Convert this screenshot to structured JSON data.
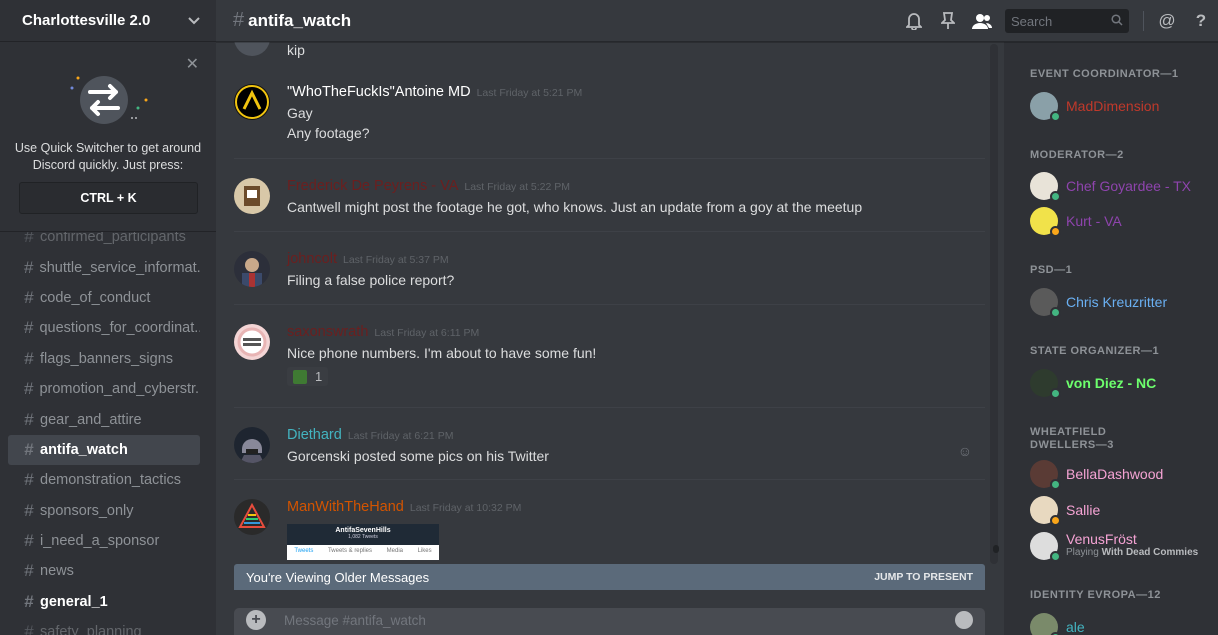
{
  "server": {
    "name": "Charlottesville 2.0"
  },
  "quick_switcher": {
    "text": "Use Quick Switcher to get around Discord quickly. Just press:",
    "shortcut": "CTRL + K"
  },
  "channels": [
    {
      "name": "confirmed_participants",
      "state": "faded"
    },
    {
      "name": "shuttle_service_informat...",
      "state": "normal"
    },
    {
      "name": "code_of_conduct",
      "state": "normal"
    },
    {
      "name": "questions_for_coordinat...",
      "state": "normal"
    },
    {
      "name": "flags_banners_signs",
      "state": "normal"
    },
    {
      "name": "promotion_and_cyberstr...",
      "state": "normal"
    },
    {
      "name": "gear_and_attire",
      "state": "normal"
    },
    {
      "name": "antifa_watch",
      "state": "active"
    },
    {
      "name": "demonstration_tactics",
      "state": "normal"
    },
    {
      "name": "sponsors_only",
      "state": "normal"
    },
    {
      "name": "i_need_a_sponsor",
      "state": "normal"
    },
    {
      "name": "news",
      "state": "normal"
    },
    {
      "name": "general_1",
      "state": "unread"
    },
    {
      "name": "safety_planning",
      "state": "faded"
    }
  ],
  "header": {
    "channel": "antifa_watch",
    "search_placeholder": "Search"
  },
  "messages": [
    {
      "top_text": "kip"
    },
    {
      "author": "\"WhoTheFuckIs\"Antoine MD",
      "color": "#ffffff",
      "time": "Last Friday at 5:21 PM",
      "lines": [
        "Gay",
        "Any footage?"
      ]
    },
    {
      "author": "Frederick De Peyrens - VA",
      "color": "#6b1f1f",
      "time": "Last Friday at 5:22 PM",
      "lines": [
        "Cantwell might post the footage he got, who knows. Just an update from a goy at the meetup"
      ]
    },
    {
      "author": "johncolt",
      "color": "#6b1f1f",
      "time": "Last Friday at 5:37 PM",
      "lines": [
        "Filing a false police report?"
      ]
    },
    {
      "author": "saxonswrath",
      "color": "#6b1f1f",
      "time": "Last Friday at 6:11 PM",
      "lines": [
        "Nice phone numbers. I'm about to have some fun!"
      ],
      "reaction_count": "1"
    },
    {
      "author": "Diethard",
      "color": "#43b4c0",
      "time": "Last Friday at 6:21 PM",
      "lines": [
        "Gorcenski posted some pics on his Twitter"
      ]
    },
    {
      "author": "ManWithTheHand",
      "color": "#d35400",
      "time": "Last Friday at 10:32 PM",
      "embed_title": "AntifaSevenHills",
      "embed_sub": "1,082 Tweets",
      "embed_tabs": [
        "Tweets",
        "Tweets & replies",
        "Media",
        "Likes"
      ]
    }
  ],
  "older_bar": {
    "text": "You're Viewing Older Messages",
    "jump": "JUMP TO PRESENT"
  },
  "composer": {
    "placeholder": "Message #antifa_watch"
  },
  "members": {
    "groups": [
      {
        "role": "EVENT COORDINATOR—1",
        "members": [
          {
            "name": "MadDimension",
            "color": "#c0392b",
            "status": "#43b581"
          }
        ]
      },
      {
        "role": "MODERATOR—2",
        "members": [
          {
            "name": "Chef Goyardee - TX",
            "color": "#8e44ad",
            "status": "#43b581"
          },
          {
            "name": "Kurt - VA",
            "color": "#8e44ad",
            "status": "#faa61a"
          }
        ]
      },
      {
        "role": "PSD—1",
        "members": [
          {
            "name": "Chris Kreuzritter",
            "color": "#6ab0f3",
            "status": "#43b581"
          }
        ]
      },
      {
        "role": "STATE ORGANIZER—1",
        "members": [
          {
            "name": "von Diez - NC",
            "color": "#6dff6d",
            "status": "#43b581"
          }
        ]
      },
      {
        "role": "WHEATFIELD DWELLERS—3",
        "members": [
          {
            "name": "BellaDashwood",
            "color": "#f5a3d4",
            "status": "#43b581"
          },
          {
            "name": "Sallie",
            "color": "#f5a3d4",
            "status": "#faa61a"
          },
          {
            "name": "VenusFröst",
            "color": "#f5a3d4",
            "status": "#43b581",
            "game_prefix": "Playing",
            "game": "With Dead Commies"
          }
        ]
      },
      {
        "role": "IDENTITY EVROPA—12",
        "members": [
          {
            "name": "ale",
            "color": "#43b4c0",
            "status": "#43b581"
          }
        ]
      }
    ]
  }
}
